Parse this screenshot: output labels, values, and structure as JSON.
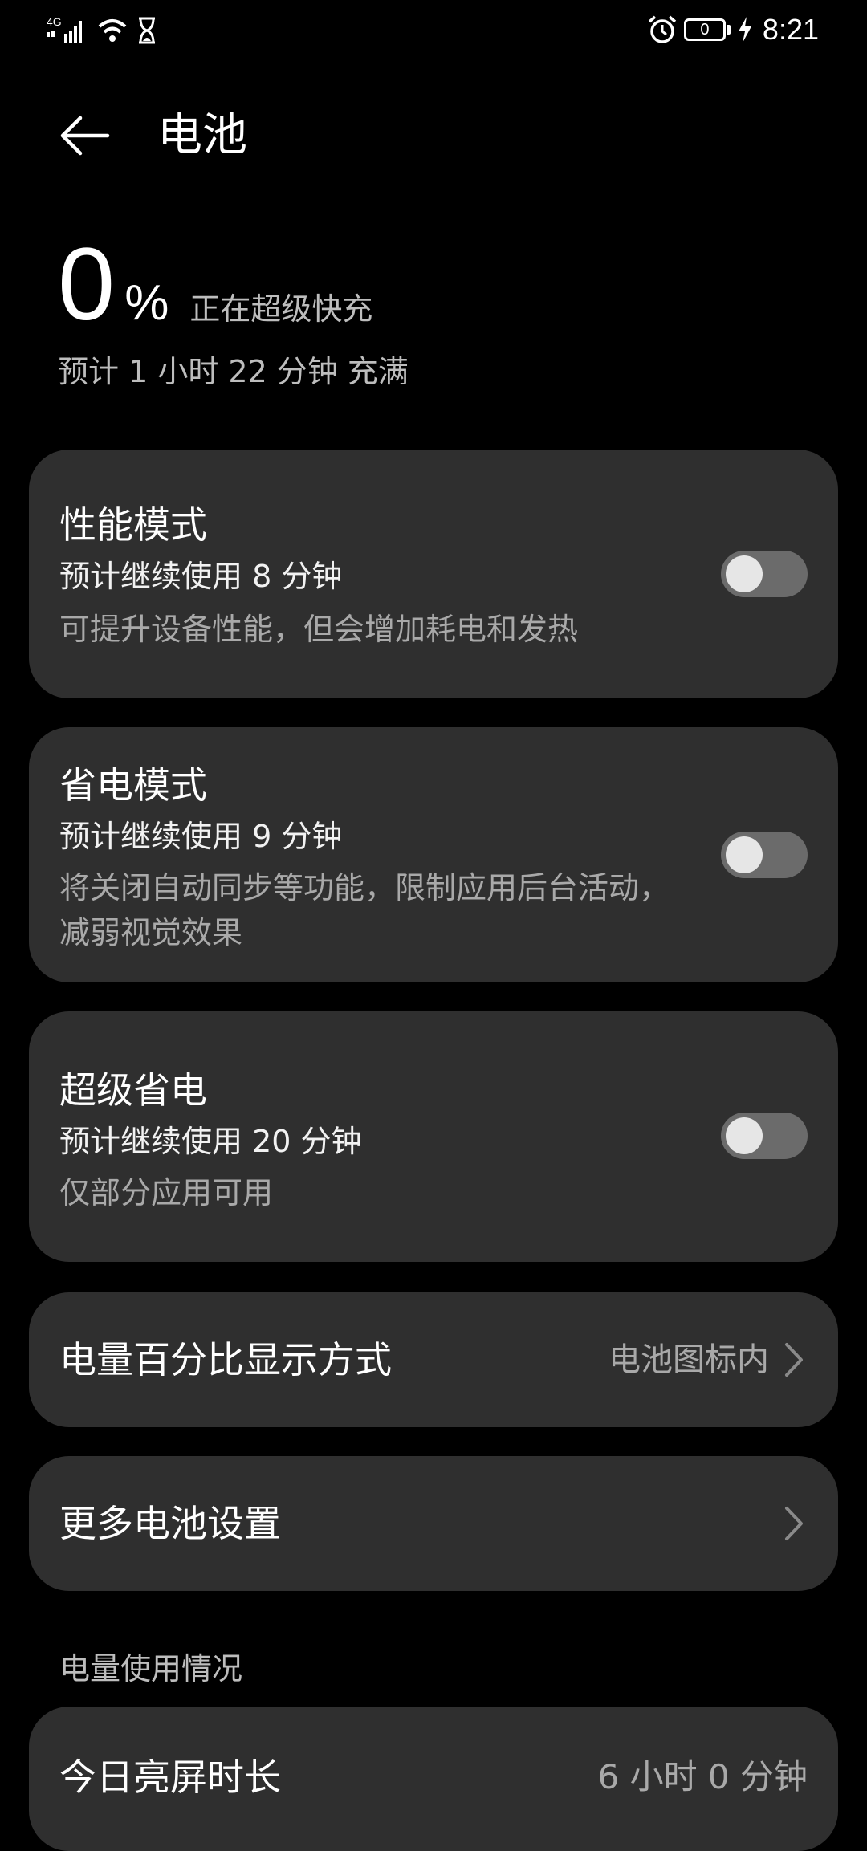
{
  "status_bar": {
    "network_label": "4G",
    "battery_level_text": "0",
    "time": "8:21",
    "icons": [
      "signal-icon",
      "wifi-icon",
      "hourglass-icon",
      "alarm-icon",
      "battery-icon",
      "charging-bolt-icon"
    ]
  },
  "header": {
    "title": "电池",
    "back_icon": "back-arrow-icon"
  },
  "summary": {
    "percent_value": "0",
    "percent_sign": "%",
    "charging_status": "正在超级快充",
    "estimate_full": "预计 1 小时 22 分钟 充满"
  },
  "modes": [
    {
      "title": "性能模式",
      "estimate": "预计继续使用 8 分钟",
      "description": "可提升设备性能，但会增加耗电和发热",
      "enabled": false
    },
    {
      "title": "省电模式",
      "estimate": "预计继续使用 9 分钟",
      "description": "将关闭自动同步等功能，限制应用后台活动，减弱视觉效果",
      "enabled": false
    },
    {
      "title": "超级省电",
      "estimate": "预计继续使用 20 分钟",
      "description": "仅部分应用可用",
      "enabled": false
    }
  ],
  "settings_rows": [
    {
      "label": "电量百分比显示方式",
      "value": "电池图标内"
    },
    {
      "label": "更多电池设置",
      "value": ""
    }
  ],
  "usage": {
    "section_title": "电量使用情况",
    "screen_on_label": "今日亮屏时长",
    "screen_on_value": "6 小时 0 分钟"
  },
  "colors": {
    "background": "#000000",
    "card": "#2f2f2f",
    "toggle_off_track": "#6b6b6b",
    "toggle_knob": "#e6e6e6",
    "secondary_text": "#a9a9a9"
  }
}
